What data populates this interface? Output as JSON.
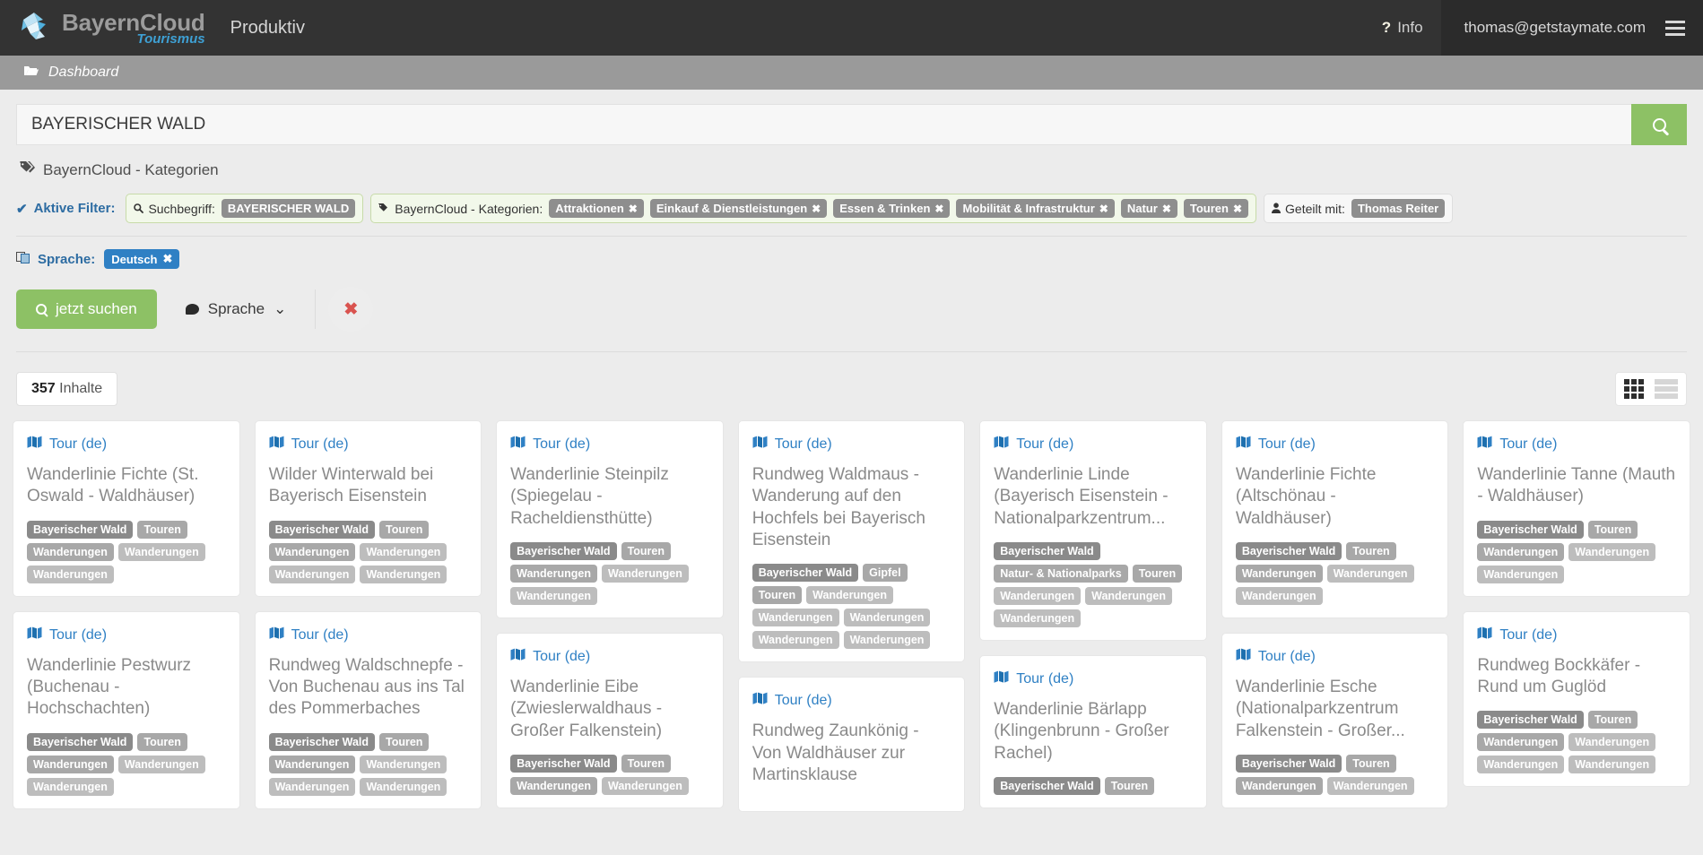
{
  "header": {
    "brand_main": "BayernCloud",
    "brand_sub": "Tourismus",
    "nav_label": "Produktiv",
    "info_label": "Info",
    "info_icon": "question-mark-icon",
    "user_email": "thomas@getstaymate.com",
    "menu_icon": "hamburger-menu-icon"
  },
  "breadcrumb": {
    "icon": "folder-open-icon",
    "label": "Dashboard"
  },
  "search": {
    "value": "BAYERISCHER WALD",
    "placeholder": "Suchbegriff",
    "button_icon": "search-icon",
    "accent_color": "#8dc165"
  },
  "category_line": {
    "icon": "tag-icon",
    "label": "BayernCloud - Kategorien"
  },
  "filters": {
    "check_icon": "check-icon",
    "title": "Aktive Filter:",
    "groups": [
      {
        "icon": "search-icon",
        "label": "Suchbegriff:",
        "chips": [
          {
            "text": "BAYERISCHER WALD",
            "removable": false
          }
        ]
      },
      {
        "icon": "tag-icon",
        "label": "BayernCloud - Kategorien:",
        "chips": [
          {
            "text": "Attraktionen",
            "removable": true
          },
          {
            "text": "Einkauf & Dienstleistungen",
            "removable": true
          },
          {
            "text": "Essen & Trinken",
            "removable": true
          },
          {
            "text": "Mobilität & Infrastruktur",
            "removable": true
          },
          {
            "text": "Natur",
            "removable": true
          },
          {
            "text": "Touren",
            "removable": true
          }
        ]
      },
      {
        "icon": "user-icon",
        "label": "Geteilt mit:",
        "plain": true,
        "chips": [
          {
            "text": "Thomas Reiter",
            "removable": false
          }
        ]
      }
    ]
  },
  "language": {
    "icon": "language-icon",
    "title": "Sprache:",
    "chip": "Deutsch",
    "chip_color": "#2f80c4"
  },
  "actions": {
    "search_label": "jetzt suchen",
    "search_icon": "search-icon",
    "language_label": "Sprache",
    "language_icon": "speech-bubble-icon",
    "caret_icon": "chevron-down-icon",
    "reset_icon": "close-x-icon",
    "reset_color": "#d9534f"
  },
  "results": {
    "count": "357",
    "count_suffix": "Inhalte",
    "grid_view_icon": "grid-view-icon",
    "list_view_icon": "list-view-icon",
    "active_view": "grid"
  },
  "cards": [
    {
      "type": "Tour (de)",
      "icon": "map-icon",
      "title": "Wanderlinie Fichte (St. Oswald - Waldhäuser)",
      "tags": [
        "Bayerischer Wald",
        "Touren",
        "Wanderungen",
        "Wanderungen",
        "Wanderungen"
      ]
    },
    {
      "type": "Tour (de)",
      "icon": "map-icon",
      "title": "Wanderlinie Pestwurz (Buchenau - Hochschachten)",
      "tags": [
        "Bayerischer Wald",
        "Touren",
        "Wanderungen",
        "Wanderungen",
        "Wanderungen"
      ]
    },
    {
      "type": "Tour (de)",
      "icon": "map-icon",
      "title": "Wilder Winterwald bei Bayerisch Eisenstein",
      "tags": [
        "Bayerischer Wald",
        "Touren",
        "Wanderungen",
        "Wanderungen",
        "Wanderungen",
        "Wanderungen"
      ]
    },
    {
      "type": "Tour (de)",
      "icon": "map-icon",
      "title": "Rundweg Waldschnepfe - Von Buchenau aus ins Tal des Pommerbaches",
      "tags": [
        "Bayerischer Wald",
        "Touren",
        "Wanderungen",
        "Wanderungen",
        "Wanderungen",
        "Wanderungen"
      ]
    },
    {
      "type": "Tour (de)",
      "icon": "map-icon",
      "title": "Wanderlinie Steinpilz (Spiegelau - Racheldiensthütte)",
      "tags": [
        "Bayerischer Wald",
        "Touren",
        "Wanderungen",
        "Wanderungen",
        "Wanderungen"
      ]
    },
    {
      "type": "Tour (de)",
      "icon": "map-icon",
      "title": "Wanderlinie Eibe (Zwieslerwaldhaus - Großer Falkenstein)",
      "tags": [
        "Bayerischer Wald",
        "Touren",
        "Wanderungen",
        "Wanderungen"
      ]
    },
    {
      "type": "Tour (de)",
      "icon": "map-icon",
      "title": "Rundweg Waldmaus - Wanderung auf den Hochfels bei Bayerisch Eisenstein",
      "tags": [
        "Bayerischer Wald",
        "Gipfel",
        "Touren",
        "Wanderungen",
        "Wanderungen",
        "Wanderungen",
        "Wanderungen",
        "Wanderungen"
      ]
    },
    {
      "type": "Tour (de)",
      "icon": "map-icon",
      "title": "Rundweg Zaunkönig - Von Waldhäuser zur Martinsklause",
      "tags": []
    },
    {
      "type": "Tour (de)",
      "icon": "map-icon",
      "title": "Wanderlinie Linde (Bayerisch Eisenstein - Nationalparkzentrum...",
      "tags": [
        "Bayerischer Wald",
        "Natur- & Nationalparks",
        "Touren",
        "Wanderungen",
        "Wanderungen",
        "Wanderungen"
      ]
    },
    {
      "type": "Tour (de)",
      "icon": "map-icon",
      "title": "Wanderlinie Bärlapp (Klingenbrunn - Großer Rachel)",
      "tags": [
        "Bayerischer Wald",
        "Touren"
      ]
    },
    {
      "type": "Tour (de)",
      "icon": "map-icon",
      "title": "Wanderlinie Fichte (Altschönau - Waldhäuser)",
      "tags": [
        "Bayerischer Wald",
        "Touren",
        "Wanderungen",
        "Wanderungen",
        "Wanderungen"
      ]
    },
    {
      "type": "Tour (de)",
      "icon": "map-icon",
      "title": "Wanderlinie Esche (Nationalparkzentrum Falkenstein - Großer...",
      "tags": [
        "Bayerischer Wald",
        "Touren",
        "Wanderungen",
        "Wanderungen"
      ]
    },
    {
      "type": "Tour (de)",
      "icon": "map-icon",
      "title": "Wanderlinie Tanne (Mauth - Waldhäuser)",
      "tags": [
        "Bayerischer Wald",
        "Touren",
        "Wanderungen",
        "Wanderungen",
        "Wanderungen"
      ]
    },
    {
      "type": "Tour (de)",
      "icon": "map-icon",
      "title": "Rundweg Bockkäfer - Rund um Guglöd",
      "tags": [
        "Bayerischer Wald",
        "Touren",
        "Wanderungen",
        "Wanderungen",
        "Wanderungen",
        "Wanderungen"
      ]
    }
  ]
}
